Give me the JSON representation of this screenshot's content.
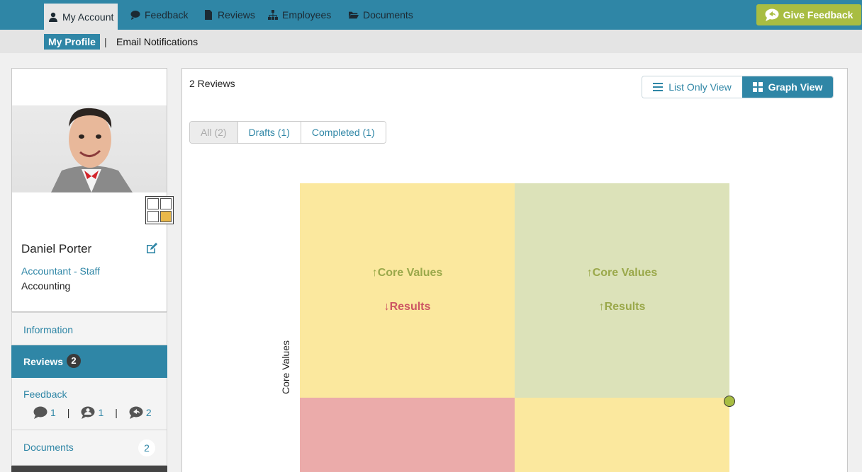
{
  "nav": {
    "items": [
      {
        "label": "My Account",
        "icon": "user-icon"
      },
      {
        "label": "Feedback",
        "icon": "comment-icon"
      },
      {
        "label": "Reviews",
        "icon": "document-icon"
      },
      {
        "label": "Employees",
        "icon": "org-chart-icon"
      },
      {
        "label": "Documents",
        "icon": "folder-icon"
      }
    ],
    "give_feedback": "Give Feedback"
  },
  "subnav": {
    "my_profile": "My Profile",
    "separator": "|",
    "email_notifications": "Email Notifications"
  },
  "profile": {
    "name": "Daniel Porter",
    "title": "Accountant - Staff",
    "department": "Accounting"
  },
  "sidebar": {
    "information": "Information",
    "reviews": {
      "label": "Reviews",
      "count": "2"
    },
    "feedback": {
      "label": "Feedback",
      "stats": [
        {
          "icon": "comment-icon",
          "count": "1"
        },
        {
          "icon": "anonymous-comment-icon",
          "count": "1"
        },
        {
          "icon": "reply-comment-icon",
          "count": "2"
        }
      ],
      "separator": "|"
    },
    "documents": {
      "label": "Documents",
      "count": "2"
    }
  },
  "main": {
    "count": "2 Reviews",
    "list_view": "List Only View",
    "graph_view": "Graph View",
    "filters": [
      {
        "label": "All (2)",
        "active": true
      },
      {
        "label": "Drafts (1)",
        "active": false
      },
      {
        "label": "Completed (1)",
        "active": false
      }
    ]
  },
  "chart_data": {
    "type": "scatter",
    "ylabel": "Core Values",
    "quadrants": [
      {
        "position": "top-left",
        "color": "#fbe89e",
        "core_values": "↑Core Values",
        "core_values_color": "#9aa84a",
        "results": "↓Results",
        "results_color": "#cc5563"
      },
      {
        "position": "top-right",
        "color": "#dce2b9",
        "core_values": "↑Core Values",
        "core_values_color": "#9aa84a",
        "results": "↑Results",
        "results_color": "#9aa84a"
      },
      {
        "position": "bottom-left",
        "color": "#ebabaa"
      },
      {
        "position": "bottom-right",
        "color": "#fbe89e"
      }
    ],
    "points": [
      {
        "results": 1.0,
        "core_values": 0.5,
        "color": "#a8bd42"
      }
    ]
  }
}
